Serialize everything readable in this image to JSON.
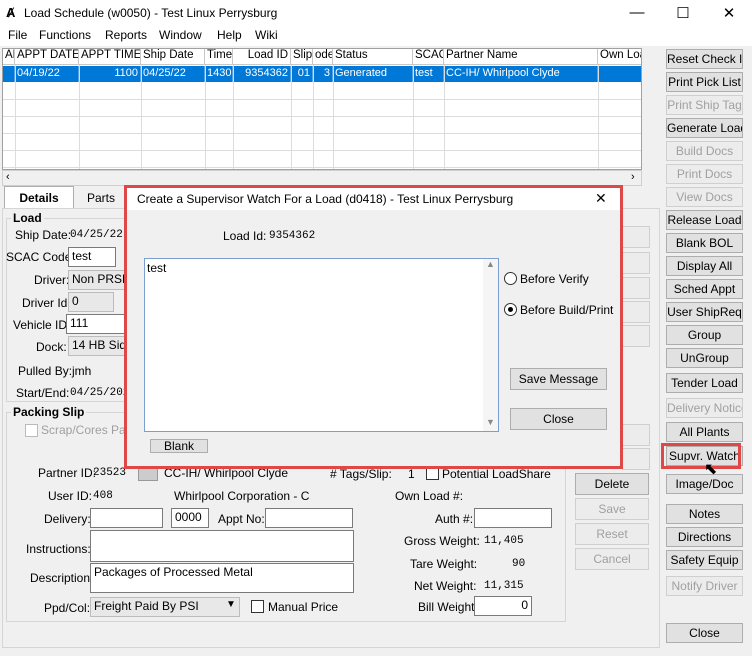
{
  "window": {
    "title": "Load Schedule (w0050) - Test Linux Perrysburg",
    "minimize": "—",
    "maximize": "☐",
    "close": "✕"
  },
  "menu": [
    "File",
    "Functions",
    "Reports",
    "Window",
    "Help",
    "Wiki"
  ],
  "grid": {
    "headers": [
      "APPT DATE",
      "APPT TIME",
      "Ship Date",
      "Time",
      "Load ID",
      "Slip",
      "ode",
      "Status",
      "SCAC",
      "Partner Name",
      "Own Loa"
    ],
    "row": [
      "04/19/22",
      "1100",
      "04/25/22",
      "1430",
      "9354362",
      "01",
      "3",
      "Generated",
      "test",
      "CC-IH/ Whirlpool Clyde",
      ""
    ]
  },
  "tabs": {
    "details": "Details",
    "parts": "Parts"
  },
  "load": {
    "group": "Load",
    "ship_date_label": "Ship Date:",
    "ship_date": "04/25/22",
    "scac_label": "SCAC Code:",
    "scac": "test",
    "driver_label": "Driver:",
    "driver": "Non PRSP",
    "driver_id_label": "Driver Id:",
    "driver_id": "0",
    "vehicle_label": "Vehicle ID:",
    "vehicle": "111",
    "dock_label": "Dock:",
    "dock": "14 HB Side L",
    "pulled_label": "Pulled By:",
    "pulled": "jmh",
    "startend_label": "Start/End:",
    "startend": "04/25/2022"
  },
  "packing": {
    "group": "Packing Slip",
    "scrap": "Scrap/Cores Packi",
    "partner_id_label": "Partner ID:",
    "partner_id": "23523",
    "partner_name": "CC-IH/ Whirlpool Clyde",
    "tags_label": "# Tags/Slip:",
    "tags": "1",
    "loadshare": "Potential LoadShare",
    "user_id_label": "User ID:",
    "user_id": "408",
    "user_name": "Whirlpool Corporation - C",
    "ownload_label": "Own Load #:",
    "delivery_label": "Delivery:",
    "delivery_time": "0000",
    "appt_label": "Appt No:",
    "auth_label": "Auth #:",
    "instructions_label": "Instructions:",
    "description_label": "Description:",
    "description": "Packages of Processed Metal",
    "gross_label": "Gross Weight:",
    "gross": "11,405",
    "tare_label": "Tare Weight:",
    "tare": "90",
    "net_label": "Net Weight:",
    "net": "11,315",
    "ppd_label": "Ppd/Col:",
    "ppd": "Freight Paid By PSI",
    "manual": "Manual Price",
    "bill_label": "Bill Weight:",
    "bill": "0"
  },
  "mid_buttons": {
    "delete": "Delete",
    "save": "Save",
    "reset": "Reset",
    "cancel": "Cancel"
  },
  "right_buttons": [
    "Reset Check In",
    "Print Pick List",
    "Print Ship Tag",
    "Generate Load",
    "Build Docs",
    "Print Docs",
    "View Docs",
    "Release Load",
    "Blank BOL",
    "Display All",
    "Sched Appt",
    "User ShipReq",
    "Group",
    "UnGroup",
    "Tender Load",
    "Delivery Notice",
    "All Plants",
    "Supvr. Watch",
    "Image/Doc",
    "Notes",
    "Directions",
    "Safety Equip",
    "Notify Driver",
    "Close"
  ],
  "dialog": {
    "title": "Create a Supervisor Watch For a Load (d0418) - Test Linux Perrysburg",
    "load_id_label": "Load Id:",
    "load_id": "9354362",
    "message": "test",
    "before_verify": "Before Verify",
    "before_build": "Before Build/Print",
    "save_message": "Save Message",
    "close": "Close",
    "blank": "Blank",
    "x": "✕"
  }
}
